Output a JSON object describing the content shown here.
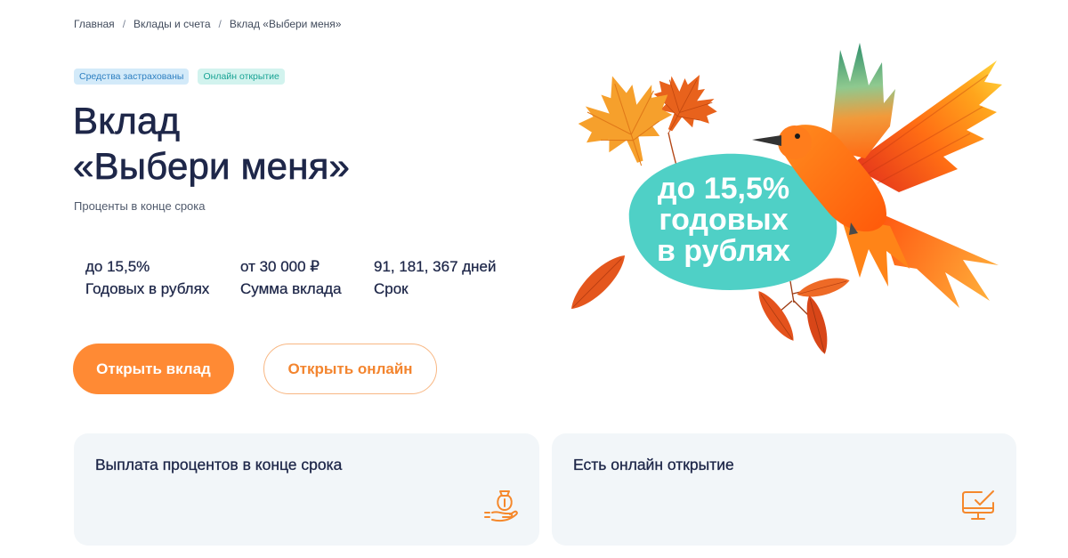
{
  "breadcrumb": {
    "items": [
      "Главная",
      "Вклады и счета",
      "Вклад «Выбери меня»"
    ],
    "separator": "/"
  },
  "badges": {
    "insured": "Средства застрахованы",
    "online": "Онлайн открытие"
  },
  "title": {
    "line1": "Вклад",
    "line2": "«Выбери меня»"
  },
  "subtitle": "Проценты в конце срока",
  "stats": [
    {
      "value": "до 15,5%",
      "label": "Годовых в рублях"
    },
    {
      "value": "от 30 000 ₽",
      "label": "Сумма вклада"
    },
    {
      "value": "91, 181, 367 дней",
      "label": "Срок"
    }
  ],
  "buttons": {
    "open_deposit": "Открыть вклад",
    "open_online": "Открыть онлайн"
  },
  "promo_bubble": {
    "lines": [
      "до 15,5%",
      "годовых",
      "в рублях"
    ]
  },
  "features": [
    {
      "title": "Выплата процентов в конце срока",
      "icon": "hand-money-bag-icon"
    },
    {
      "title": "Есть онлайн открытие",
      "icon": "monitor-check-icon"
    }
  ],
  "colors": {
    "text_primary": "#1e2749",
    "accent": "#ff8a34",
    "promo_bubble": "#4fd0c6",
    "card_background": "#f2f6f9",
    "badge_insured": "#2d7fc1",
    "badge_online": "#18a394"
  }
}
